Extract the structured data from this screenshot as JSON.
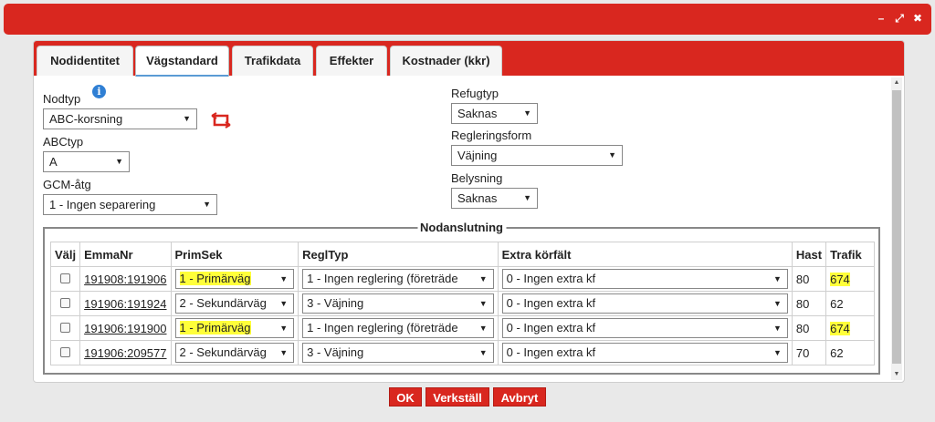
{
  "titlebar": {
    "minimize": "–",
    "restore": "⤢",
    "close": "✖"
  },
  "tabs": [
    {
      "label": "Nodidentitet",
      "active": false
    },
    {
      "label": "Vägstandard",
      "active": true
    },
    {
      "label": "Trafikdata",
      "active": false
    },
    {
      "label": "Effekter",
      "active": false
    },
    {
      "label": "Kostnader (kkr)",
      "active": false
    }
  ],
  "form": {
    "nodtyp": {
      "label": "Nodtyp",
      "value": "ABC-korsning"
    },
    "abctyp": {
      "label": "ABCtyp",
      "value": "A"
    },
    "gcm": {
      "label": "GCM-åtg",
      "value": "1 - Ingen separering"
    },
    "refugtyp": {
      "label": "Refugtyp",
      "value": "Saknas"
    },
    "regleringsform": {
      "label": "Regleringsform",
      "value": "Väjning"
    },
    "belysning": {
      "label": "Belysning",
      "value": "Saknas"
    }
  },
  "nodanslutning": {
    "legend": "Nodanslutning",
    "columns": [
      "Välj",
      "EmmaNr",
      "PrimSek",
      "ReglTyp",
      "Extra körfält",
      "Hast",
      "Trafik"
    ],
    "rows": [
      {
        "emma": "191908:191906",
        "primsek": "1 - Primärväg",
        "regltyp": "1 - Ingen reglering (företräde",
        "extra": "0 - Ingen extra kf",
        "hast": "80",
        "trafik": "674",
        "highlight": true
      },
      {
        "emma": "191906:191924",
        "primsek": "2 - Sekundärväg",
        "regltyp": "3 - Väjning",
        "extra": "0 - Ingen extra kf",
        "hast": "80",
        "trafik": "62",
        "highlight": false
      },
      {
        "emma": "191906:191900",
        "primsek": "1 - Primärväg",
        "regltyp": "1 - Ingen reglering (företräde",
        "extra": "0 - Ingen extra kf",
        "hast": "80",
        "trafik": "674",
        "highlight": true
      },
      {
        "emma": "191906:209577",
        "primsek": "2 - Sekundärväg",
        "regltyp": "3 - Väjning",
        "extra": "0 - Ingen extra kf",
        "hast": "70",
        "trafik": "62",
        "highlight": false
      }
    ]
  },
  "buttons": {
    "ok": "OK",
    "apply": "Verkställ",
    "cancel": "Avbryt"
  },
  "icons": {
    "info": "i",
    "dropdown": "▼",
    "scroll_up": "▲",
    "scroll_down": "▼"
  },
  "colors": {
    "accent": "#d9271f",
    "highlight": "#ffff3a",
    "info": "#2f7fd4"
  }
}
